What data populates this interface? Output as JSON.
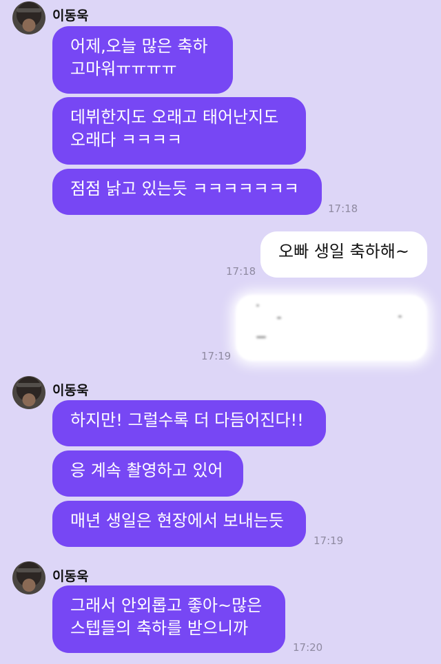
{
  "chat": {
    "sender_name": "이동욱",
    "group1": {
      "messages": [
        "어제,오늘 많은 축하\n고마워ㅠㅠㅠㅠ",
        "데뷔한지도 오래고 태어난지도\n오래다 ㅋㅋㅋㅋ",
        "점점 낡고 있는듯 ㅋㅋㅋㅋㅋㅋㅋ"
      ],
      "time": "17:18"
    },
    "my_message": {
      "text": "오빠 생일 축하해~",
      "time": "17:18"
    },
    "blurred_message": {
      "time": "17:19"
    },
    "group2": {
      "messages": [
        "하지만! 그럴수록 더 다듬어진다!!",
        "응 계속 촬영하고 있어",
        "매년 생일은 현장에서 보내는듯"
      ],
      "time": "17:19"
    },
    "group3": {
      "messages": [
        "그래서 안외롭고 좋아~많은\n스텝들의 축하를 받으니까"
      ],
      "time": "17:20"
    }
  },
  "colors": {
    "background": "#ddd6f7",
    "incoming_bubble": "#7747f4",
    "outgoing_bubble": "#ffffff",
    "timestamp": "#8f8aa1"
  }
}
